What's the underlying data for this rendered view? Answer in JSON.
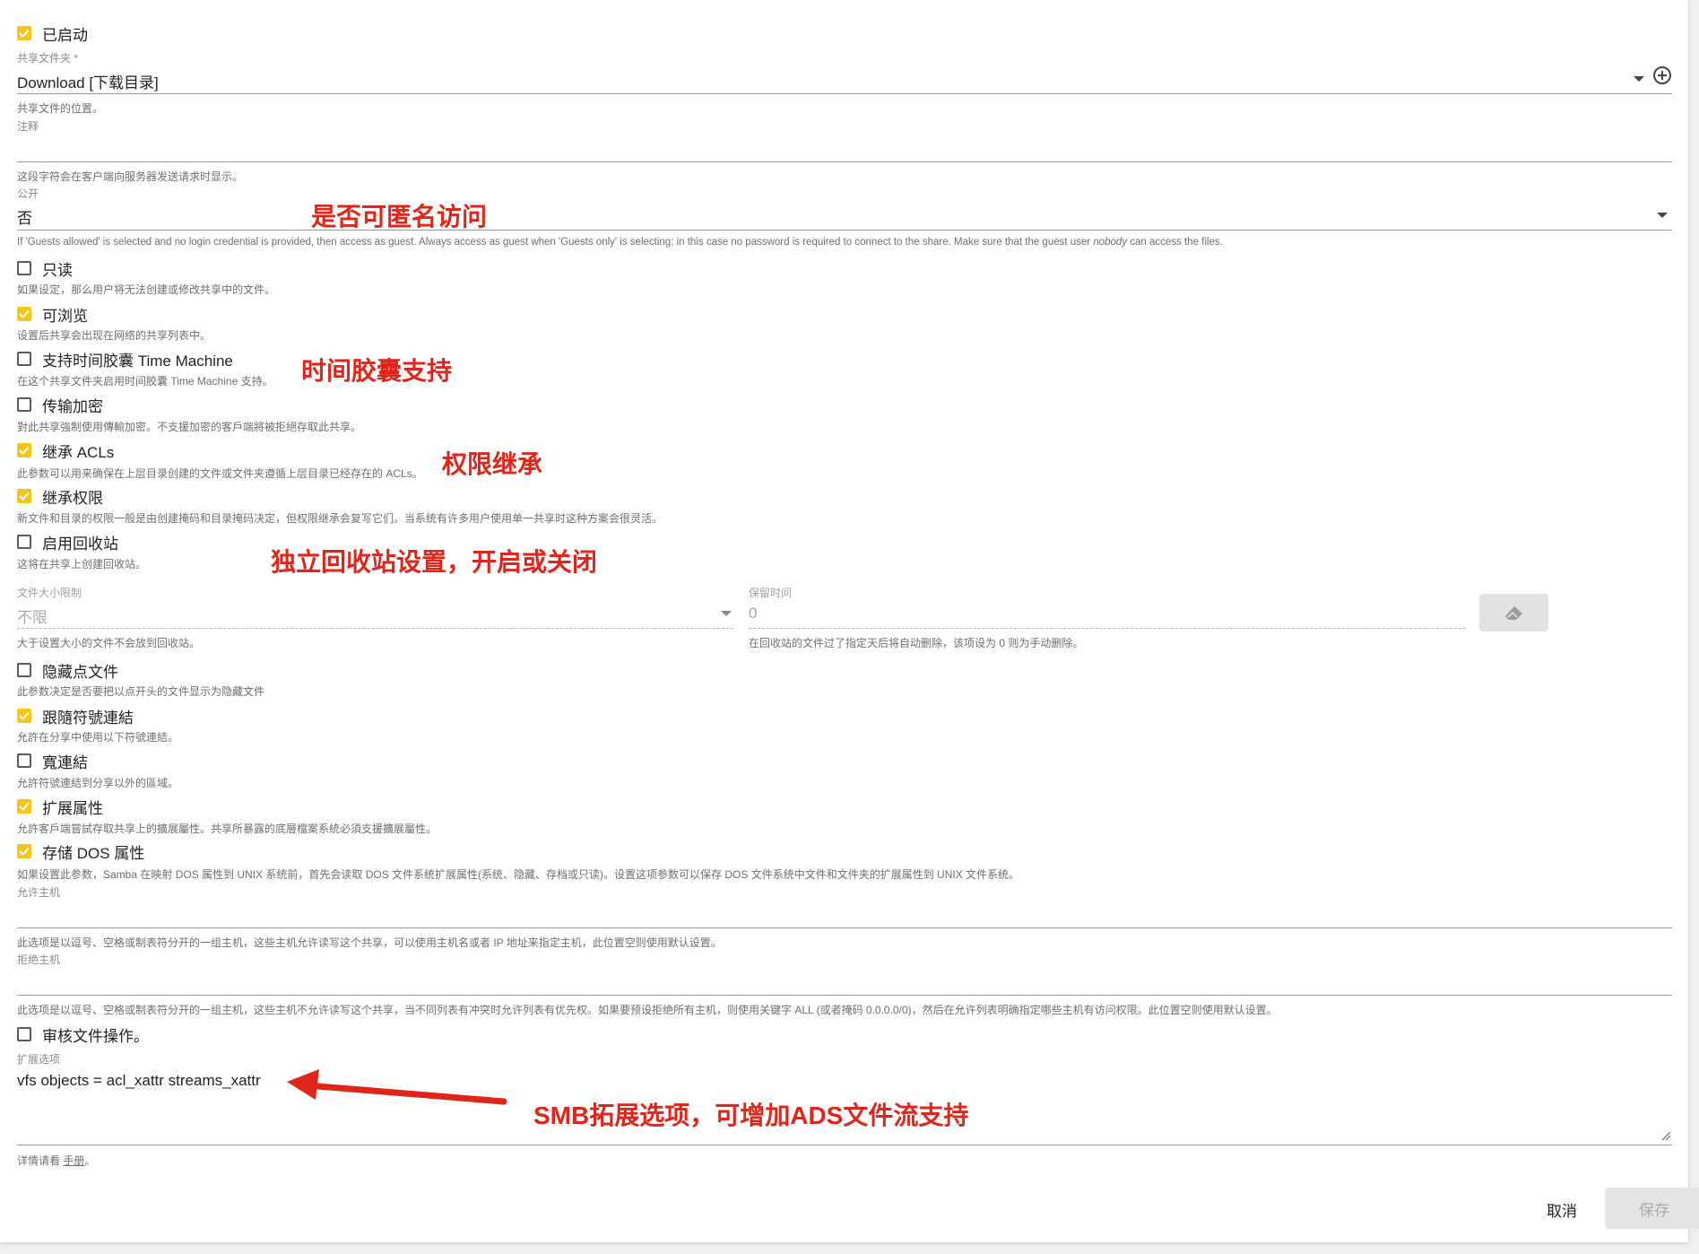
{
  "fields": {
    "enabled": {
      "label": "已启动",
      "checked": true
    },
    "shared_folder": {
      "label": "共享文件夹 *",
      "value": "Download [下载目录]",
      "hint": "共享文件的位置。"
    },
    "comment": {
      "label": "注释",
      "value": "",
      "hint": "这段字符会在客户端向服务器发送请求时显示。"
    },
    "public": {
      "label": "公开",
      "value": "否",
      "hint_pre": "If 'Guests allowed' is selected and no login credential is provided, then access as guest. Always access as guest when 'Guests only' is selecting; in this case no password is required to connect to the share. Make sure that the guest user ",
      "hint_em": "nobody",
      "hint_post": " can access the files."
    },
    "checkboxes_a": [
      {
        "label": "只读",
        "checked": false,
        "hint": "如果设定，那么用户将无法创建或修改共享中的文件。"
      },
      {
        "label": "可浏览",
        "checked": true,
        "hint": "设置后共享会出现在网络的共享列表中。"
      },
      {
        "label": "支持时间胶囊 Time Machine",
        "checked": false,
        "hint": "在这个共享文件夹启用时间胶囊 Time Machine 支持。"
      },
      {
        "label": "传输加密",
        "checked": false,
        "hint": "對此共享強制使用傳輸加密。不支援加密的客戶端將被拒絕存取此共享。"
      },
      {
        "label": "继承 ACLs",
        "checked": true,
        "hint": "此参数可以用来确保在上层目录创建的文件或文件夹遵循上层目录已经存在的 ACLs。"
      },
      {
        "label": "继承权限",
        "checked": true,
        "hint": "新文件和目录的权限一般是由创建掩码和目录掩码决定，但权限继承会复写它们。当系统有许多用户使用单一共享时这种方案会很灵活。"
      },
      {
        "label": "启用回收站",
        "checked": false,
        "hint": "这将在共享上创建回收站。"
      }
    ],
    "recycle": {
      "size_label": "文件大小限制",
      "size_value": "不限",
      "size_hint": "大于设置大小的文件不会放到回收站。",
      "retention_label": "保留时间",
      "retention_value": "0",
      "retention_hint": "在回收站的文件过了指定天后将自动删除，该项设为 0 则为手动删除。"
    },
    "checkboxes_b": [
      {
        "label": "隐藏点文件",
        "checked": false,
        "hint": "此参数决定是否要把以点开头的文件显示为隐藏文件"
      },
      {
        "label": "跟隨符號連結",
        "checked": true,
        "hint": "允許在分享中使用以下符號連結。"
      },
      {
        "label": "寬連結",
        "checked": false,
        "hint": "允許符號連結到分享以外的區域。"
      },
      {
        "label": "扩展属性",
        "checked": true,
        "hint": "允許客戶端嘗試存取共享上的擴展屬性。共享所暴露的底層檔案系統必須支援擴展屬性。"
      },
      {
        "label": "存储 DOS 属性",
        "checked": true,
        "hint": "如果设置此参数，Samba 在映射 DOS 属性到 UNIX 系统前，首先会读取 DOS 文件系统扩展属性(系统、隐藏、存档或只读)。设置这项参数可以保存 DOS 文件系统中文件和文件夹的扩展属性到 UNIX 文件系统。"
      }
    ],
    "hosts_allow": {
      "label": "允许主机",
      "value": "",
      "hint": "此选项是以逗号、空格或制表符分开的一组主机，这些主机允许读写这个共享，可以使用主机名或者 IP 地址来指定主机，此位置空则使用默认设置。"
    },
    "hosts_deny": {
      "label": "拒绝主机",
      "value": "",
      "hint": "此选项是以逗号、空格或制表符分开的一组主机，这些主机不允许读写这个共享，当不同列表有冲突时允许列表有优先权。如果要预设拒绝所有主机，则使用关键字 ALL (或者掩码 0.0.0.0/0)，然后在允许列表明确指定哪些主机有访问权限。此位置空则使用默认设置。"
    },
    "audit": {
      "label": "审核文件操作。",
      "checked": false
    },
    "extra_options": {
      "label": "扩展选项",
      "value": "vfs objects = acl_xattr streams_xattr",
      "hint_pre": "详情请看 ",
      "hint_link": "手册",
      "hint_post": "。"
    }
  },
  "buttons": {
    "cancel": "取消",
    "save": "保存"
  },
  "annotations": {
    "anonymous": "是否可匿名访问",
    "time_machine": "时间胶囊支持",
    "acl_inherit": "权限继承",
    "recycle": "独立回收站设置，开启或关闭",
    "smb_extra": "SMB拓展选项，可增加ADS文件流支持"
  },
  "colors": {
    "accent": "#f5c518",
    "annotation": "#e0261a"
  }
}
